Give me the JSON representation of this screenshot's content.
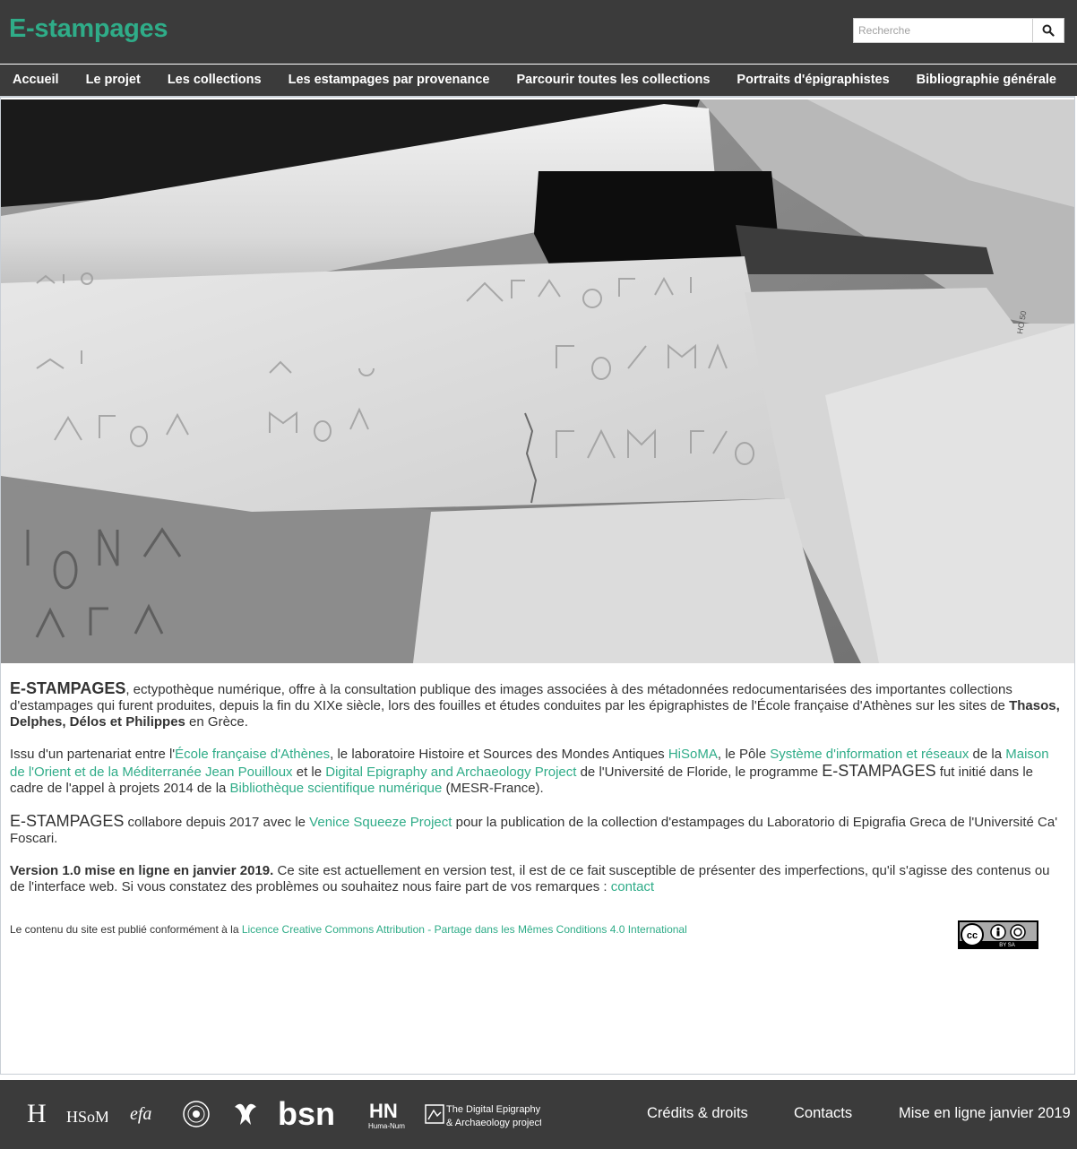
{
  "header": {
    "logo": "E-stampages",
    "search_placeholder": "Recherche"
  },
  "nav": {
    "items": [
      "Accueil",
      "Le projet",
      "Les collections",
      "Les estampages par provenance",
      "Parcourir toutes les collections",
      "Portraits d'épigraphistes",
      "Bibliographie générale"
    ]
  },
  "content": {
    "p1": {
      "brand": "E-STAMPAGES",
      "t1": ", ectypothèque numérique, offre à la consultation publique des images associées à des métadonnées redocumentarisées des importantes collections d'estampages qui furent produites, depuis la fin du XIXe siècle, lors des fouilles et études conduites par les épigraphistes de l'École française d'Athènes sur les sites de ",
      "sites": "Thasos, Delphes, Délos et Philippes",
      "t2": " en Grèce."
    },
    "p2": {
      "t1": "Issu d'un partenariat entre l'",
      "l1": "École française d'Athènes",
      "t2": ", le laboratoire Histoire et Sources des Mondes Antiques ",
      "l2": "HiSoMA",
      "t3": ", le Pôle ",
      "l3": "Système d'information et réseaux",
      "t4": " de la ",
      "l4": "Maison de l'Orient et de la Méditerranée Jean Pouilloux",
      "t5": " et le ",
      "l5": "Digital Epigraphy and Archaeology Project",
      "t6": " de l'Université de Floride, le programme ",
      "brand": "E-STAMPAGES",
      "t7": " fut initié dans le cadre de l'appel à projets 2014 de la ",
      "l6": "Bibliothèque scientifique numérique",
      "t8": " (MESR-France)."
    },
    "p3": {
      "brand": "E-STAMPAGES",
      "t1": " collabore depuis 2017 avec le ",
      "l1": "Venice Squeeze Project",
      "t2": " pour la publication de la collection d'estampages du Laboratorio di Epigrafia Greca de l'Université Ca' Foscari."
    },
    "p4": {
      "version": "Version 1.0 mise en ligne en janvier 2019.",
      "t1": " Ce site est actuellement en version test, il est de ce fait susceptible de présenter des imperfections, qu'il s'agisse des contenus ou de l'interface web. Si vous constatez des problèmes ou souhaitez nous faire part de vos remarques : ",
      "contact": "contact"
    },
    "license": {
      "t1": "Le contenu du site est publié conformément à la ",
      "link": "Licence Creative Commons Attribution - Partage dans les Mêmes Conditions 4.0 International"
    },
    "cc_badge_text": "BY    SA"
  },
  "footer": {
    "partners": {
      "hisoma": "HSoMA",
      "efa": "efa",
      "bsn": "bsn",
      "humanum": "Huma-Num",
      "dea_line1": "The Digital Epigraphy",
      "dea_line2": "& Archaeology project"
    },
    "links": [
      "Crédits & droits",
      "Contacts",
      "Mise en ligne janvier 2019"
    ]
  },
  "colors": {
    "accent": "#2fac88",
    "header_bg": "#3b3b3b",
    "text": "#333333"
  }
}
